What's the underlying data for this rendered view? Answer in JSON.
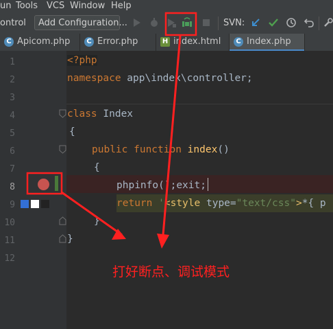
{
  "menubar": {
    "items": [
      "un",
      "Tools",
      "VCS",
      "Window",
      "Help"
    ]
  },
  "toolbar": {
    "left_label": "ontrol",
    "config_label": "Add Configuration...",
    "svn_label": "SVN:"
  },
  "tabs": [
    {
      "label": "Apicom.php",
      "icon": "php-class-icon",
      "active": false
    },
    {
      "label": "Error.php",
      "icon": "php-class-icon",
      "active": false
    },
    {
      "label": "index.html",
      "icon": "html-file-icon",
      "active": false
    },
    {
      "label": "Index.php",
      "icon": "php-class-icon",
      "active": true
    }
  ],
  "line_numbers": [
    "1",
    "2",
    "3",
    "4",
    "5",
    "6",
    "7",
    "8",
    "9",
    "10",
    "11",
    "12"
  ],
  "code": {
    "l1": "<?php",
    "l2_kw": "namespace",
    "l2_rest": " app\\index\\controller;",
    "l4_kw": "class",
    "l4_name": " Index",
    "l5": "{",
    "l6_kw": "public function",
    "l6_fn": " index",
    "l6_rest": "()",
    "l7": "{",
    "l8_a": "phpinfo",
    "l8_b": "();",
    "l8_c": "exit;",
    "l9_kw": "return",
    "l9_str": " '",
    "l9_tag": "<style",
    "l9_attr": " type=",
    "l9_val": "\"text/css\"",
    "l9_tag2": ">",
    "l9_rest": "*{ p",
    "l10": "}",
    "l11": "}"
  },
  "annotation": {
    "text": "打好断点、调试模式"
  },
  "colors": {
    "annotation": "#ff2020",
    "breakpoint": "#c75450"
  }
}
